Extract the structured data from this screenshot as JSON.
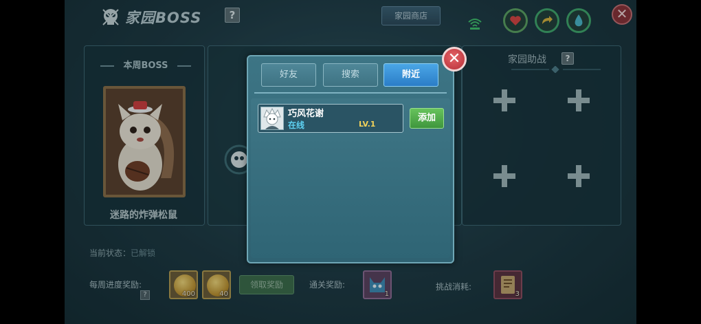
{
  "header": {
    "title": "家园BOSS",
    "help": "?",
    "shop_label": "家园商店",
    "close": "✕"
  },
  "boss": {
    "week_label": "本周BOSS",
    "name": "迷路的炸弹松鼠"
  },
  "helpers": {
    "title": "家园助战",
    "help": "?",
    "slots": [
      "+",
      "+",
      "+",
      "+"
    ]
  },
  "status": {
    "label": "当前状态：",
    "value": "已解锁"
  },
  "rewards": {
    "weekly_label": "每周进度奖励:",
    "weekly_help": "?",
    "items": [
      {
        "count": "400"
      },
      {
        "count": "40"
      }
    ],
    "claim_label": "领取奖励",
    "clear_label": "通关奖励:",
    "clear_item_count": "1",
    "cost_label": "挑战消耗:",
    "cost_item_count": "3"
  },
  "icons": {
    "heart": "heart-icon",
    "arrow": "arrow-icon",
    "drop": "drop-icon"
  },
  "modal": {
    "close": "✕",
    "tabs": [
      {
        "label": "好友",
        "active": false
      },
      {
        "label": "搜索",
        "active": false
      },
      {
        "label": "附近",
        "active": true
      }
    ],
    "friends": [
      {
        "name": "巧风花谢",
        "status": "在线",
        "level": "LV.1",
        "action": "添加"
      }
    ]
  },
  "colors": {
    "active_tab": "#2b7dc7",
    "add_button": "#4fae48",
    "online": "#5ed1f2",
    "level": "#f3d35a",
    "close": "#c93a42"
  }
}
